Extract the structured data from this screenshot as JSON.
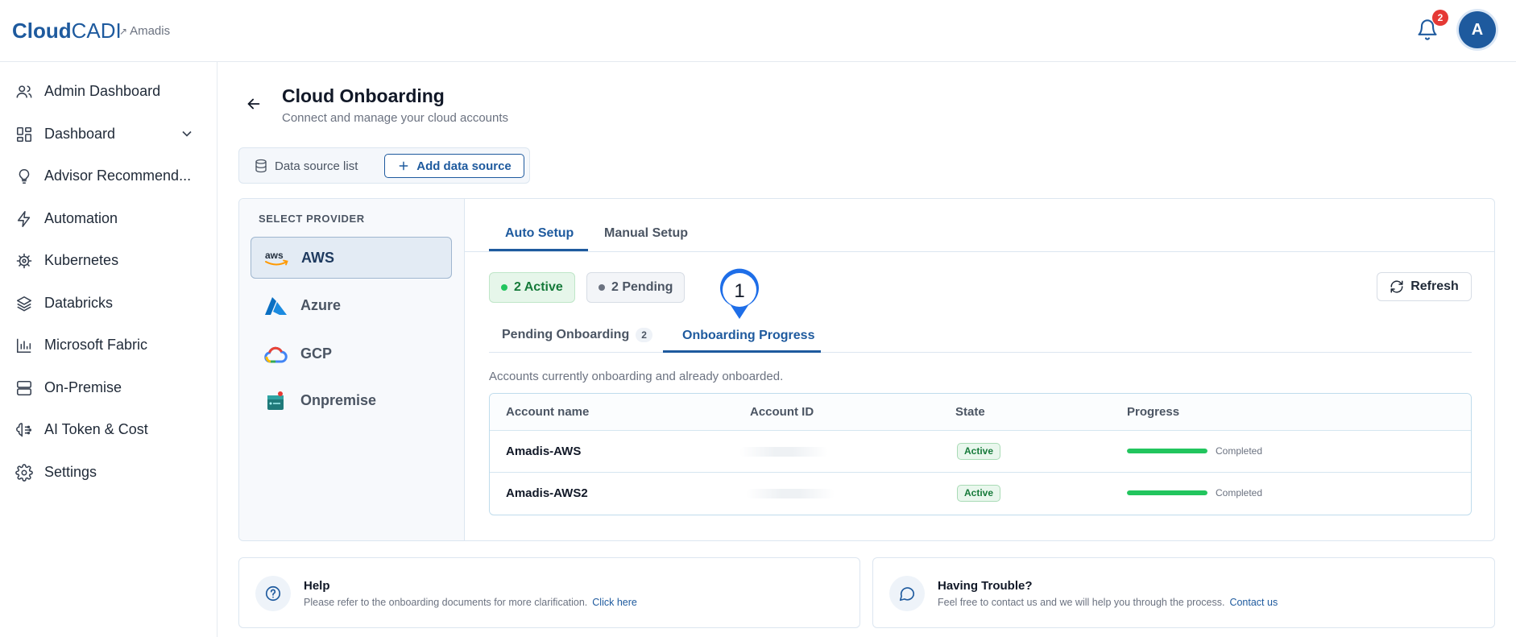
{
  "header": {
    "logo_bold": "Cloud",
    "logo_light": "CADI",
    "tenant": "Amadis",
    "notification_count": "2",
    "avatar_initial": "A"
  },
  "sidebar": {
    "items": [
      {
        "label": "Admin Dashboard",
        "icon": "users-icon"
      },
      {
        "label": "Dashboard",
        "icon": "grid-icon"
      },
      {
        "label": "Advisor Recommend...",
        "icon": "lightbulb-icon"
      },
      {
        "label": "Automation",
        "icon": "bolt-icon"
      },
      {
        "label": "Kubernetes",
        "icon": "helm-icon"
      },
      {
        "label": "Databricks",
        "icon": "layers-icon"
      },
      {
        "label": "Microsoft Fabric",
        "icon": "bar-chart-icon"
      },
      {
        "label": "On-Premise",
        "icon": "server-icon"
      },
      {
        "label": "AI Token & Cost",
        "icon": "ai-brain-icon"
      },
      {
        "label": "Settings",
        "icon": "gear-icon"
      }
    ]
  },
  "page": {
    "title": "Cloud Onboarding",
    "subtitle": "Connect and manage your cloud accounts"
  },
  "segments": {
    "list_label": "Data source list",
    "add_label": "Add data source"
  },
  "providers": {
    "heading": "SELECT PROVIDER",
    "items": [
      {
        "label": "AWS",
        "selected": true
      },
      {
        "label": "Azure",
        "selected": false
      },
      {
        "label": "GCP",
        "selected": false
      },
      {
        "label": "Onpremise",
        "selected": false
      }
    ]
  },
  "setup_tabs": {
    "auto": "Auto Setup",
    "manual": "Manual Setup"
  },
  "status": {
    "active": "2 Active",
    "pending": "2 Pending",
    "refresh": "Refresh",
    "active_color": "#22c55e",
    "pending_color": "#6b7280"
  },
  "step_marker": "1",
  "onboarding_tabs": {
    "pending": "Pending Onboarding",
    "pending_count": "2",
    "progress": "Onboarding Progress"
  },
  "description": "Accounts currently onboarding and already onboarded.",
  "table": {
    "headers": {
      "name": "Account name",
      "id": "Account ID",
      "state": "State",
      "progress": "Progress"
    },
    "rows": [
      {
        "name": "Amadis-AWS",
        "state": "Active",
        "progress": 1.0,
        "progress_label": "Completed"
      },
      {
        "name": "Amadis-AWS2",
        "state": "Active",
        "progress": 1.0,
        "progress_label": "Completed"
      }
    ]
  },
  "help": {
    "title": "Help",
    "text": "Please refer to the onboarding documents for more clarification.",
    "link": "Click here"
  },
  "trouble": {
    "title": "Having Trouble?",
    "text": "Feel free to contact us and we will help you through the process.",
    "link": "Contact us"
  }
}
